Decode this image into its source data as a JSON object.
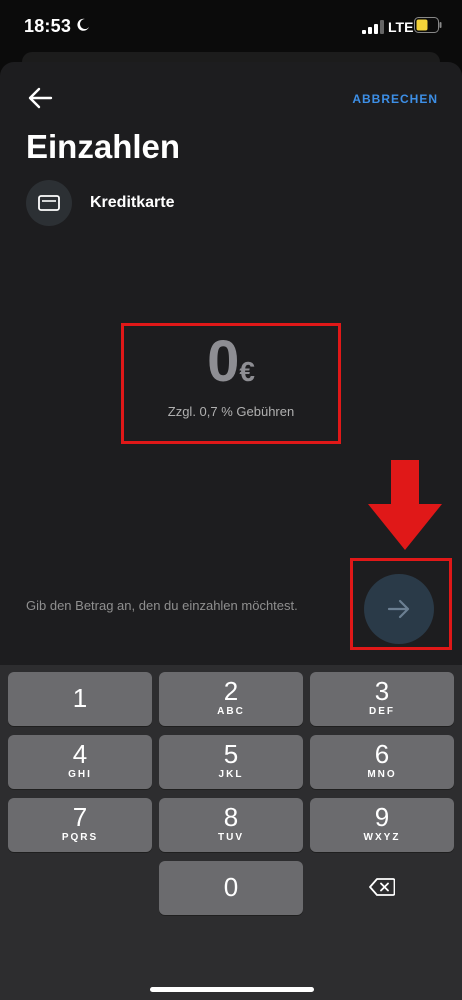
{
  "status_bar": {
    "time": "18:53",
    "network": "LTE"
  },
  "header": {
    "cancel_label": "ABBRECHEN",
    "title": "Einzahlen"
  },
  "payment_method": {
    "label": "Kreditkarte"
  },
  "amount": {
    "value": "0",
    "currency": "€",
    "fee_note": "Zzgl. 0,7 % Gebühren"
  },
  "hint": "Gib den Betrag an, den du einzahlen möchtest.",
  "keypad": {
    "keys": [
      {
        "digit": "1",
        "letters": ""
      },
      {
        "digit": "2",
        "letters": "ABC"
      },
      {
        "digit": "3",
        "letters": "DEF"
      },
      {
        "digit": "4",
        "letters": "GHI"
      },
      {
        "digit": "5",
        "letters": "JKL"
      },
      {
        "digit": "6",
        "letters": "MNO"
      },
      {
        "digit": "7",
        "letters": "PQRS"
      },
      {
        "digit": "8",
        "letters": "TUV"
      },
      {
        "digit": "9",
        "letters": "WXYZ"
      },
      {
        "digit": "0",
        "letters": ""
      }
    ]
  },
  "colors": {
    "accent": "#3d8fe6",
    "annotation": "#e01818",
    "background": "#1d1d1f",
    "key": "#6b6b6e"
  }
}
